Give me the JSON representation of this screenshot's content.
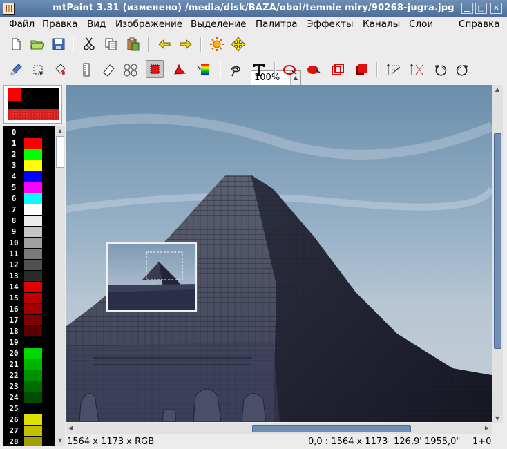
{
  "window": {
    "title": "mtPaint 3.31 (изменено) /media/disk/BAZA/oboi/temnie miry/90268-jugra.jpg",
    "controls": [
      "minimize",
      "maximize",
      "close"
    ]
  },
  "menubar": {
    "items": [
      {
        "first": "Ф",
        "rest": "айл"
      },
      {
        "first": "П",
        "rest": "равка"
      },
      {
        "first": "В",
        "rest": "ид"
      },
      {
        "first": "И",
        "rest": "зображение"
      },
      {
        "first": "В",
        "rest": "ыделение"
      },
      {
        "first": "П",
        "rest": "алитра"
      },
      {
        "first": "Э",
        "rest": "ффекты"
      },
      {
        "first": "К",
        "rest": "аналы"
      },
      {
        "first": "С",
        "rest": "лои"
      },
      {
        "first": "С",
        "rest": "правка"
      }
    ]
  },
  "toolbar_main": {
    "icons": [
      "new-file-icon",
      "open-folder-icon",
      "save-icon",
      "cut-icon",
      "copy-icon",
      "paste-icon",
      "undo-arrow-icon",
      "redo-arrow-icon",
      "sun-brightness-icon",
      "pan-move-icon"
    ],
    "zoom_value": "100%"
  },
  "toolbar_tools": {
    "icons": [
      "pencil-icon",
      "select-rect-icon",
      "flood-fill-icon",
      "ruler-icon",
      "eraser-icon",
      "clone-icon",
      "polygon-select-icon",
      "lasso-icon",
      "gradient-icon",
      "spiral-lasso-icon",
      "text-tool-icon",
      "outline-ellipse-icon",
      "filled-ellipse-icon",
      "outline-rect-icon",
      "filled-rect-icon",
      "flip-vertical-icon",
      "flip-horizontal-icon",
      "rotate-ccw-icon",
      "rotate-cw-icon"
    ],
    "active": "select-rect-icon"
  },
  "colors": {
    "accent": "#4a6d97",
    "foreground": "#ff0000",
    "background": "#000000"
  },
  "palette": {
    "entries": [
      {
        "n": "0",
        "c": "#000000"
      },
      {
        "n": "1",
        "c": "#ff0000"
      },
      {
        "n": "2",
        "c": "#00ff00"
      },
      {
        "n": "3",
        "c": "#ffff00"
      },
      {
        "n": "4",
        "c": "#0000ff"
      },
      {
        "n": "5",
        "c": "#ff00ff"
      },
      {
        "n": "6",
        "c": "#00ffff"
      },
      {
        "n": "7",
        "c": "#ffffff"
      },
      {
        "n": "8",
        "c": "#ebebeb"
      },
      {
        "n": "9",
        "c": "#c4c4c4"
      },
      {
        "n": "10",
        "c": "#9f9f9f"
      },
      {
        "n": "11",
        "c": "#7a7a7a"
      },
      {
        "n": "12",
        "c": "#505050"
      },
      {
        "n": "13",
        "c": "#2b2b2b"
      },
      {
        "n": "14",
        "c": "#e00000"
      },
      {
        "n": "15",
        "c": "#c00000"
      },
      {
        "n": "16",
        "c": "#a00000"
      },
      {
        "n": "17",
        "c": "#800000"
      },
      {
        "n": "18",
        "c": "#5a0000"
      },
      {
        "n": "19",
        "c": "#000000"
      },
      {
        "n": "20",
        "c": "#00d800"
      },
      {
        "n": "21",
        "c": "#00b400"
      },
      {
        "n": "22",
        "c": "#009000"
      },
      {
        "n": "23",
        "c": "#006c00"
      },
      {
        "n": "24",
        "c": "#004c00"
      },
      {
        "n": "25",
        "c": "#000000"
      },
      {
        "n": "26",
        "c": "#e0e000"
      },
      {
        "n": "27",
        "c": "#c0c000"
      },
      {
        "n": "28",
        "c": "#a0a000"
      }
    ]
  },
  "status": {
    "image_info": "1564 x 1173 x RGB",
    "coords": "0,0 : 1564 x 1173",
    "geo": "126,9' 1955,0\"",
    "layer": "1+0"
  }
}
